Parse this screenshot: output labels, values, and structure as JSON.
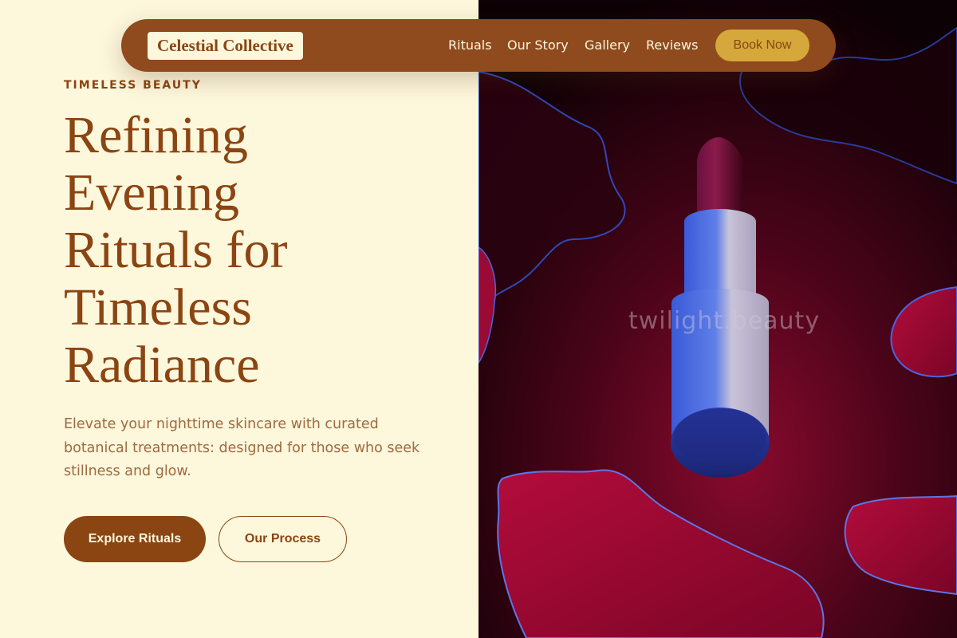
{
  "brand": {
    "logo_text": "Celestial Collective"
  },
  "nav": {
    "items": [
      {
        "label": "Rituals"
      },
      {
        "label": "Our Story"
      },
      {
        "label": "Gallery"
      },
      {
        "label": "Reviews"
      }
    ],
    "cta_label": "Book Now"
  },
  "hero": {
    "eyebrow": "TIMELESS BEAUTY",
    "headline_lines": [
      "Refining",
      "Evening",
      "Rituals for",
      "Timeless",
      "Radiance"
    ],
    "subtext": "Elevate your nighttime skincare with curated botanical treatments: designed for those who seek stillness and glow.",
    "primary_button": "Explore Rituals",
    "secondary_button": "Our Process"
  },
  "image": {
    "watermark": "twilight.beauty",
    "subject": "lipstick-icon"
  },
  "colors": {
    "background": "#fdf7dc",
    "brand_brown": "#8b4513",
    "nav_brown": "#8f4a1d",
    "accent_gold": "#d4a83a",
    "subtext": "#a0693f",
    "image_crimson": "#8a0a2e"
  }
}
